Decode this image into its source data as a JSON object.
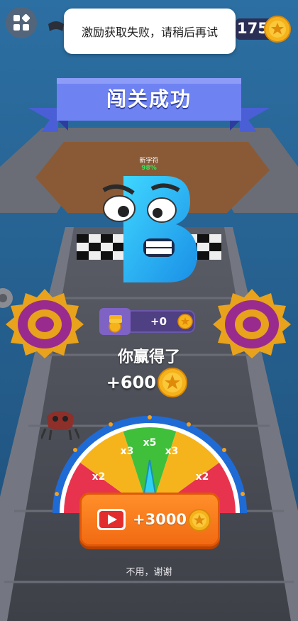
{
  "hud": {
    "coin_count": "175",
    "toast_message": "激励获取失败，请稍后再试"
  },
  "result": {
    "title": "闯关成功",
    "new_character_label": "新字符",
    "progress_percent": "98%",
    "character_letter": "B"
  },
  "reward": {
    "bar_value": "+0",
    "won_label": "你赢得了",
    "won_amount": "+600"
  },
  "wheel": {
    "multipliers": [
      "x2",
      "x3",
      "x5",
      "x3",
      "x2"
    ]
  },
  "actions": {
    "watch_ad_amount": "+3000",
    "decline_label": "不用，谢谢"
  },
  "colors": {
    "banner": "#6f82f2",
    "coin": "#f6b21b",
    "button": "#f5781a",
    "wheel_red": "#e8334f",
    "wheel_yellow": "#f5b41c",
    "wheel_green": "#3fbf3a"
  }
}
